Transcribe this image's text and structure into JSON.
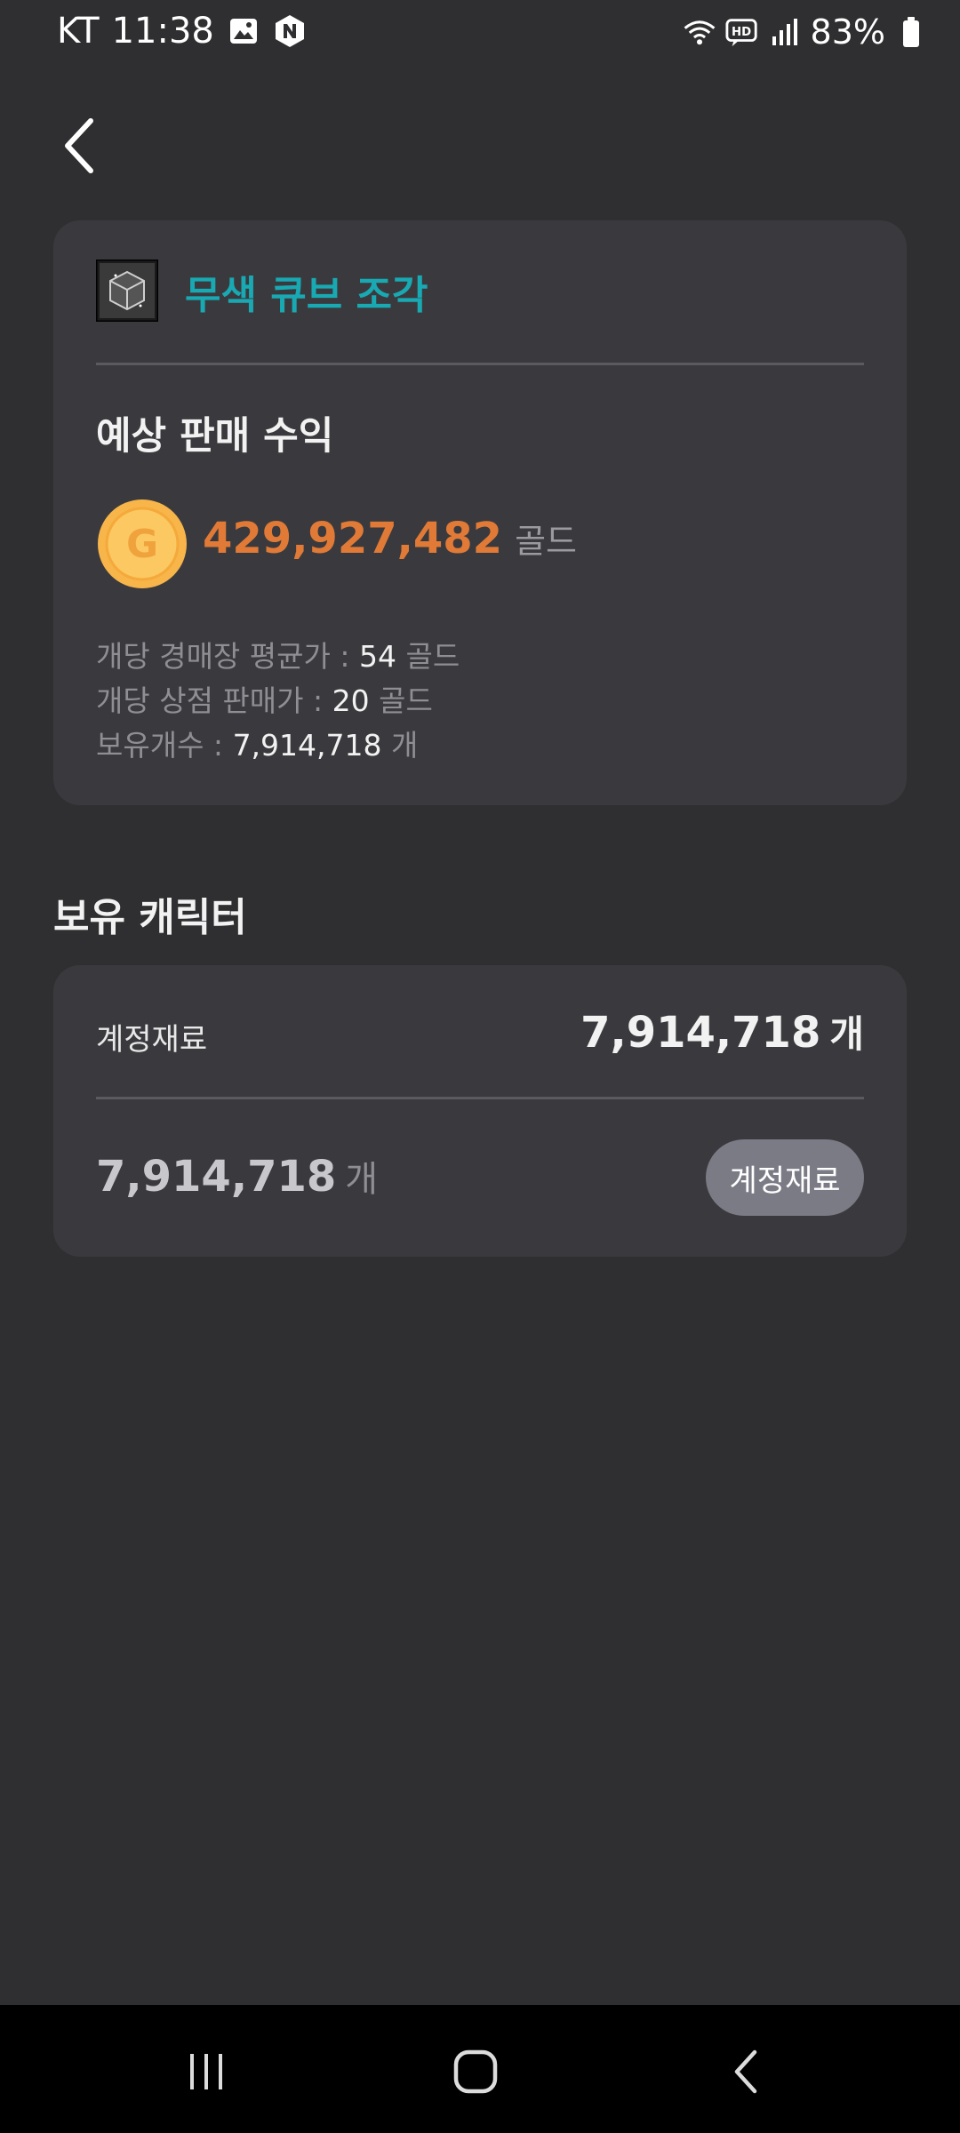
{
  "status_bar": {
    "carrier": "KT",
    "time": "11:38",
    "battery": "83%",
    "icons_left": [
      "gallery-icon",
      "naver-icon"
    ],
    "icons_right": [
      "wifi-icon",
      "hd-voice-icon",
      "signal-icon",
      "battery-icon"
    ]
  },
  "item": {
    "name": "무색 큐브 조각",
    "name_color": "#19a9b3",
    "icon": "cube-fragment-icon"
  },
  "profit": {
    "title": "예상 판매 수익",
    "value": "429,927,482",
    "unit": "골드",
    "value_color": "#e07a36",
    "coin_letter": "G"
  },
  "info": {
    "auction_label": "개당 경매장 평균가 :",
    "auction_value": "54",
    "auction_unit": "골드",
    "shop_label": "개당 상점 판매가 :",
    "shop_value": "20",
    "shop_unit": "골드",
    "owned_label": "보유개수 :",
    "owned_value": "7,914,718",
    "owned_unit": "개"
  },
  "characters": {
    "title": "보유 캐릭터",
    "account_label": "계정재료",
    "account_count": "7,914,718",
    "account_unit": "개",
    "row_count": "7,914,718",
    "row_unit": "개",
    "row_button": "계정재료"
  }
}
